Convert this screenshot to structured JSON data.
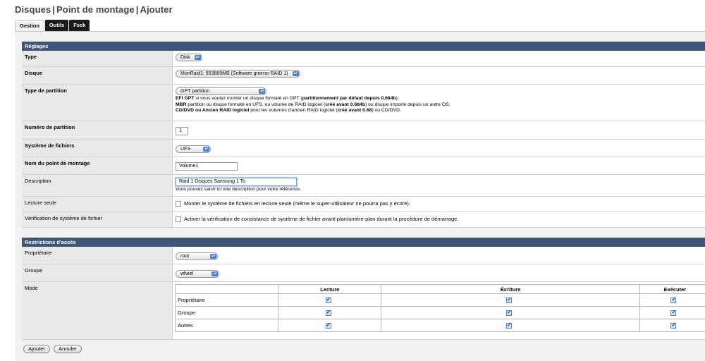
{
  "breadcrumb": [
    "Disques",
    "Point de montage",
    "Ajouter"
  ],
  "tabs": [
    {
      "label": "Gestion",
      "active": true
    },
    {
      "label": "Outils",
      "active": false
    },
    {
      "label": "Fsck",
      "active": false
    }
  ],
  "settings": {
    "header": "Réglages",
    "type": {
      "label": "Type",
      "value": "Disk"
    },
    "disque": {
      "label": "Disque",
      "value": "MonRaid1: 953869MB (Software gmirror RAID 1)"
    },
    "partition_type": {
      "label": "Type de partition",
      "value": "GPT partition",
      "help1_b1": "EFI GPT",
      "help1_t1": " si vous voulez monter un disque formaté en GPT (",
      "help1_b2": "partitionnement par défaut depuis 0.684b",
      "help1_t2": ").",
      "help2_b1": "MBR",
      "help2_t1": " partition ou disque formaté en UFS, ou volume de RAID logiciel (",
      "help2_b2": "créé avant 0.684b",
      "help2_t2": ") ou disque importé depuis un autre OS.",
      "help3_b1": "CD/DVD ou Ancien RAID logiciel",
      "help3_t1": " pour les volumes d'ancien RAID logiciel (",
      "help3_b2": "créé avant 0.68",
      "help3_t2": ") ou CD/DVD."
    },
    "partition_number": {
      "label": "Numéro de partition",
      "value": "1"
    },
    "filesystem": {
      "label": "Système de fichiers",
      "value": "UFS"
    },
    "mount_name": {
      "label": "Nom du point de montage",
      "value": "Volume1"
    },
    "description": {
      "label": "Description",
      "value": "Raid 1 Disques Samsung 1 To",
      "help": "Vous pouvez saisir ici une description pour votre référence."
    },
    "readonly": {
      "label": "Lecture seule",
      "text": "Monter le système de fichiers en lecture seule (même le super-utilisateur ne pourra pas y écrire).",
      "checked": false
    },
    "fsck": {
      "label": "Vérification de système de fichier",
      "text": "Activer la vérification de consistance de système de fichier avant-plan/arrière-plan durant la procédure de démarrage.",
      "checked": false
    }
  },
  "access": {
    "header": "Restrictions d'accès",
    "owner": {
      "label": "Propriétaire",
      "value": "root"
    },
    "group": {
      "label": "Groupe",
      "value": "wheel"
    },
    "mode": {
      "label": "Mode",
      "columns": [
        "Lecture",
        "Écriture",
        "Exécuter"
      ],
      "rows": [
        {
          "label": "Propriétaire",
          "read": true,
          "write": true,
          "exec": true
        },
        {
          "label": "Groupe",
          "read": true,
          "write": true,
          "exec": true
        },
        {
          "label": "Autres",
          "read": true,
          "write": true,
          "exec": true
        }
      ]
    }
  },
  "buttons": {
    "add": "Ajouter",
    "cancel": "Annuler"
  },
  "colors": {
    "section_header": "#3f5679",
    "panel_bg": "#f2f2f2",
    "tab_dark": "#1a1a1a",
    "select_accent": "#4b7fd3"
  }
}
